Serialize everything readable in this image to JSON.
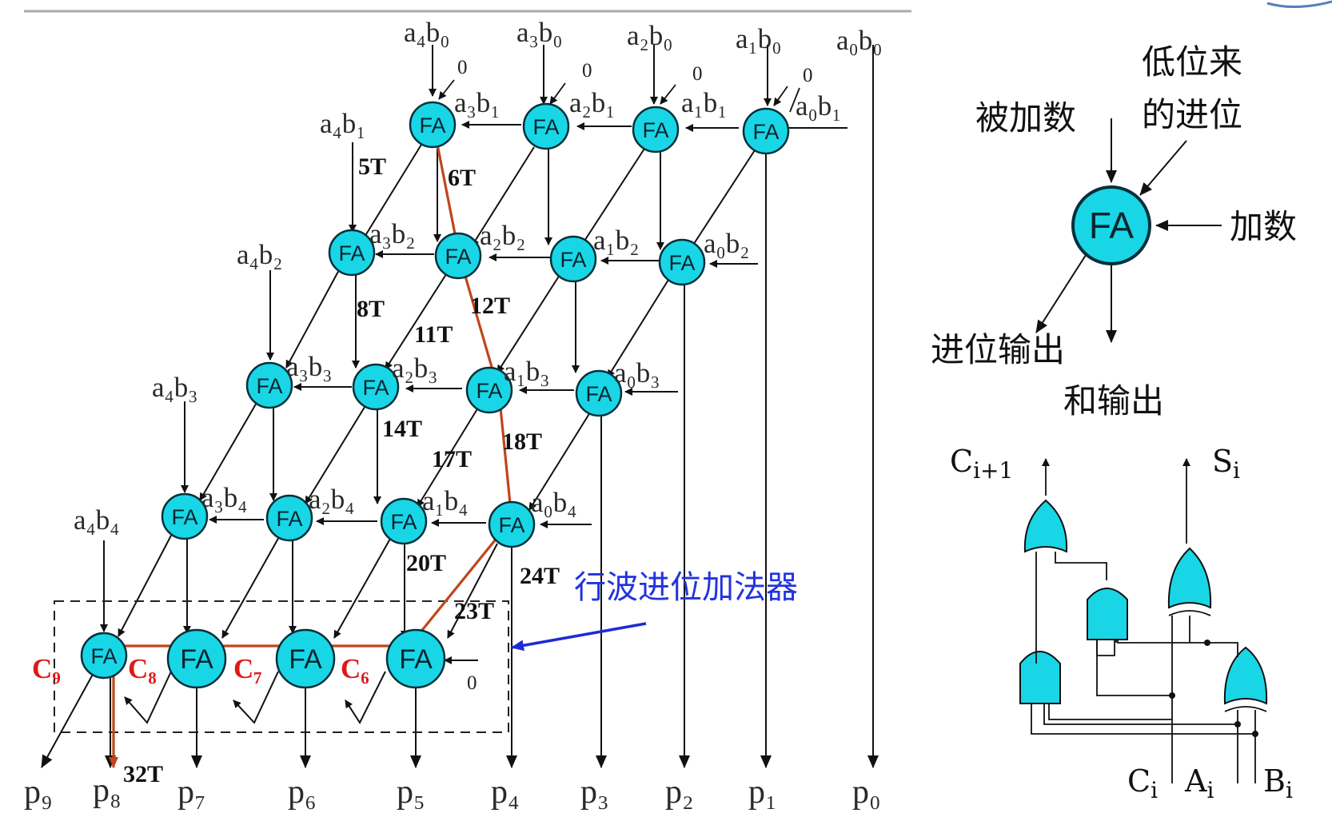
{
  "left_array": {
    "top_inputs": [
      "a₄b₀",
      "a₃b₀",
      "a₂b₀",
      "a₁b₀",
      "a₀b₀"
    ],
    "carry_zero": "0",
    "row_inputs": [
      [
        "a₄b₁",
        "a₃b₁",
        "a₂b₁",
        "a₁b₁",
        "a₀b₁"
      ],
      [
        "a₄b₂",
        "a₃b₂",
        "a₂b₂",
        "a₁b₂",
        "a₀b₂"
      ],
      [
        "a₄b₃",
        "a₃b₃",
        "a₂b₃",
        "a₁b₃",
        "a₀b₃"
      ],
      [
        "a₄b₄",
        "a₃b₄",
        "a₂b₄",
        "a₁b₄",
        "a₀b₄"
      ]
    ],
    "fa_label": "FA",
    "timing": [
      "5T",
      "6T",
      "8T",
      "11T",
      "12T",
      "14T",
      "17T",
      "18T",
      "20T",
      "23T",
      "24T",
      "32T"
    ],
    "carries": [
      "C₉",
      "C₈",
      "C₇",
      "C₆"
    ],
    "outputs": [
      "p₉",
      "p₈",
      "p₇",
      "p₆",
      "p₅",
      "p₄",
      "p₃",
      "p₂",
      "p₁",
      "p₀"
    ],
    "ripple_label": "行波进位加法器",
    "ripple_carry_in": "0"
  },
  "fa_symbol": {
    "label": "FA",
    "augend": "被加数",
    "carry_in_line1": "低位来",
    "carry_in_line2": "的进位",
    "addend": "加数",
    "carry_out": "进位输出",
    "sum_out": "和输出"
  },
  "gate_circuit": {
    "c_out": "C",
    "c_out_sub": "i+1",
    "s_out": "S",
    "s_out_sub": "i",
    "inputs": [
      [
        "C",
        "i"
      ],
      [
        "A",
        "i"
      ],
      [
        "B",
        "i"
      ]
    ]
  },
  "colors": {
    "fa_fill": "#19d6e6",
    "critical_path": "#c0461b",
    "carry_label": "#e01818",
    "ripple_label": "#2233dd"
  }
}
